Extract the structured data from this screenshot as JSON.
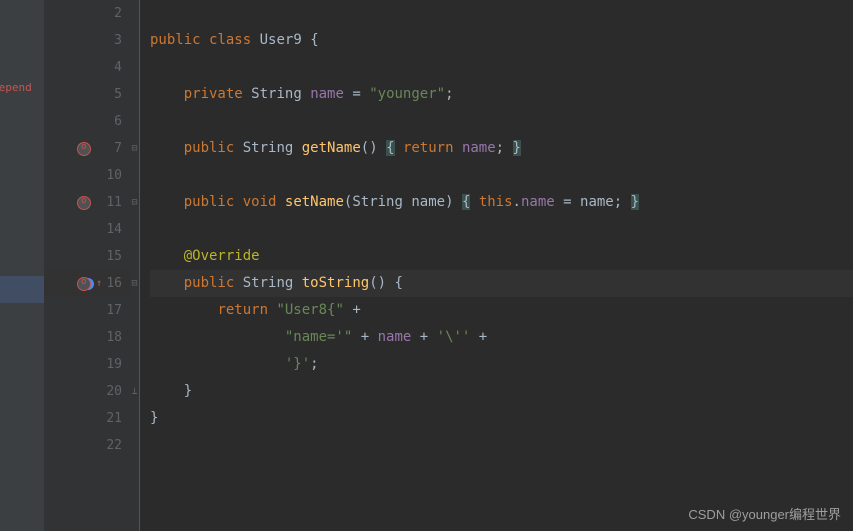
{
  "sidebar": {
    "label": "Depend"
  },
  "gutter": {
    "lines": [
      "2",
      "3",
      "4",
      "5",
      "6",
      "7",
      "10",
      "11",
      "14",
      "15",
      "16",
      "17",
      "18",
      "19",
      "20",
      "21",
      "22"
    ]
  },
  "code": {
    "l2": "",
    "l3": {
      "kw1": "public",
      "kw2": "class",
      "cls": "User9",
      "b": "{"
    },
    "l4": "",
    "l5": {
      "kw": "private",
      "type": "String",
      "field": "name",
      "eq": "=",
      "str": "\"younger\"",
      "sc": ";"
    },
    "l6": "",
    "l7": {
      "kw": "public",
      "type": "String",
      "method": "getName",
      "p": "()",
      "b1": "{",
      "ret": "return",
      "field": "name",
      "sc": ";",
      "b2": "}"
    },
    "l10": "",
    "l11": {
      "kw": "public",
      "void": "void",
      "method": "setName",
      "p1": "(",
      "ptype": "String",
      "pname": "name",
      "p2": ")",
      "b1": "{",
      "this": "this",
      "dot": ".",
      "field": "name",
      "eq": "=",
      "arg": "name",
      "sc": ";",
      "b2": "}"
    },
    "l14": "",
    "l15": {
      "anno": "@Override"
    },
    "l16": {
      "kw": "public",
      "type": "String",
      "method": "toString",
      "p": "()",
      "b": "{"
    },
    "l17": {
      "ret": "return",
      "str": "\"User8{\"",
      "plus": "+"
    },
    "l18": {
      "str1": "\"name='\"",
      "plus1": "+",
      "field": "name",
      "plus2": "+",
      "str2": "'\\''",
      "plus3": "+"
    },
    "l19": {
      "str": "'}'",
      "sc": ";"
    },
    "l20": {
      "b": "}"
    },
    "l21": {
      "b": "}"
    },
    "l22": ""
  },
  "watermark": "CSDN @younger编程世界"
}
